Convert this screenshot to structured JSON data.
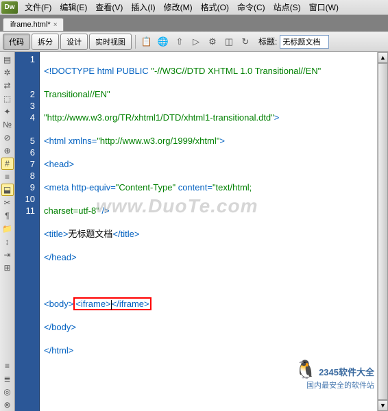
{
  "app": {
    "logo": "Dw"
  },
  "menu": {
    "file": "文件(F)",
    "edit": "编辑(E)",
    "view": "查看(V)",
    "insert": "插入(I)",
    "modify": "修改(M)",
    "format": "格式(O)",
    "commands": "命令(C)",
    "site": "站点(S)",
    "window": "窗口(W)"
  },
  "tab": {
    "name": "iframe.html*",
    "close": "×"
  },
  "toolbar": {
    "code": "代码",
    "split": "拆分",
    "design": "设计",
    "live": "实时视图",
    "title_label": "标题:",
    "title_value": "无标题文档"
  },
  "gutter": [
    "1",
    "2",
    "3",
    "4",
    "5",
    "6",
    "7",
    "8",
    "9",
    "10",
    "11"
  ],
  "code": {
    "l1a": "<!DOCTYPE html PUBLIC ",
    "l1b": "\"-//W3C//DTD XHTML 1.0 Transitional//EN\"",
    "l1c": "\"http://www.w3.org/TR/xhtml1/DTD/xhtml1-transitional.dtd\"",
    "l1d": ">",
    "l2a": "<html ",
    "l2b": "xmlns",
    "l2c": "=",
    "l2d": "\"http://www.w3.org/1999/xhtml\"",
    "l2e": ">",
    "l3": "<head>",
    "l4a": "<meta ",
    "l4b": "http-equiv",
    "l4c": "=",
    "l4d": "\"Content-Type\"",
    "l4e": " content",
    "l4f": "=",
    "l4g": "\"text/html; charset=utf-8\"",
    "l4h": " />",
    "l5a": "<title>",
    "l5b": "无标题文档",
    "l5c": "</title>",
    "l6": "</head>",
    "l8a": "<body>",
    "l8b": "<iframe>",
    "l8c": "</iframe>",
    "l9": "</body>",
    "l10": "</html>"
  },
  "watermark": "www.DuoTe.com",
  "corner": {
    "line1": "2345软件大全",
    "line2": "国内最安全的软件站"
  }
}
